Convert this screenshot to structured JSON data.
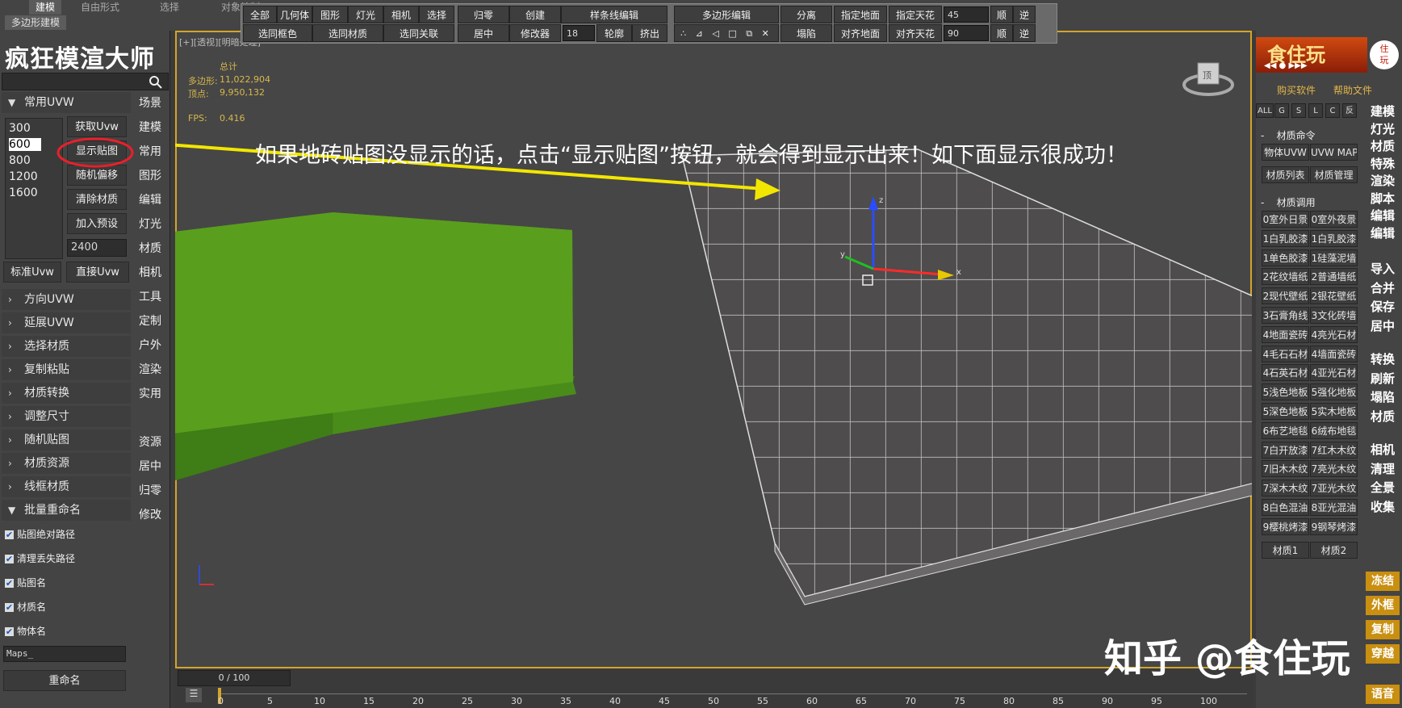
{
  "ribbon": {
    "tabs": [
      "建模",
      "自由形式",
      "选择",
      "对象绘制"
    ],
    "active_tab": "建模",
    "subtab": "多边形建模"
  },
  "toolbar": {
    "row1": [
      "全部",
      "几何体",
      "图形",
      "灯光",
      "相机",
      "选择",
      "归零",
      "创建",
      "样条线编辑",
      "多边形编辑",
      "分离",
      "指定地面",
      "指定天花",
      "顺",
      "逆"
    ],
    "row2": [
      "选同框色",
      "选同材质",
      "选同关联",
      "居中",
      "修改器",
      "轮廓",
      "挤出",
      "塌陷",
      "对齐地面",
      "对齐天花",
      "顺",
      "逆"
    ],
    "spinner_outline": "18",
    "spinner_angle1": "45",
    "spinner_angle2": "90"
  },
  "left": {
    "title": "疯狂模渲大师",
    "search_icon": "search-icon",
    "sec_common_uvw": "常用UVW",
    "sizes": [
      "300",
      "600",
      "800",
      "1200",
      "1600"
    ],
    "selected_size": "600",
    "btn_get_uvw": "获取Uvw",
    "btn_show_map": "显示贴图",
    "btn_random_offset": "随机偏移",
    "btn_clear_material": "清除材质",
    "btn_add_preset": "加入预设",
    "size_input": "2400",
    "btn_standard_uvw": "标准Uvw",
    "btn_direct_uvw": "直接Uvw",
    "nav": [
      "场景",
      "建模",
      "常用",
      "图形",
      "编辑",
      "灯光",
      "材质",
      "相机",
      "工具",
      "定制",
      "户外",
      "渲染",
      "实用",
      "资源",
      "居中",
      "归零",
      "修改"
    ],
    "sections": [
      "方向UVW",
      "延展UVW",
      "选择材质",
      "复制粘贴",
      "材质转换",
      "调整尺寸",
      "随机贴图",
      "材质资源",
      "线框材质"
    ],
    "sec_batch_rename": "批量重命名",
    "checks": [
      "贴图绝对路径",
      "清理丢失路径",
      "贴图名",
      "材质名",
      "物体名"
    ],
    "rename_input": "Maps_",
    "btn_rename": "重命名"
  },
  "viewport": {
    "label": "[+][透视][明暗处理]",
    "stats_title": "总计",
    "poly_label": "多边形:",
    "poly_value": "11,022,904",
    "vert_label": "顶点:",
    "vert_value": "9,950,132",
    "fps_label": "FPS:",
    "fps_value": "0.416",
    "annotation": "如果地砖贴图没显示的话，点击“显示贴图”按钮，就会得到显示出来！如下面显示很成功！",
    "gizmo_x": "x",
    "gizmo_y": "y",
    "gizmo_z": "z",
    "cube_label": "顶"
  },
  "timeline": {
    "slider": "0 / 100",
    "ticks": [
      "0",
      "5",
      "10",
      "15",
      "20",
      "25",
      "30",
      "35",
      "40",
      "45",
      "50",
      "55",
      "60",
      "65",
      "70",
      "75",
      "80",
      "85",
      "90",
      "95",
      "100"
    ]
  },
  "right": {
    "logo_text": "食住玩",
    "logo_sub": "住\n玩",
    "link_buy": "购买软件",
    "link_help": "帮助文件",
    "filters": [
      "ALL",
      "G",
      "S",
      "L",
      "C",
      "反"
    ],
    "head_material_cmd": "材质命令",
    "btn_obj_uvw": "物体UVW",
    "btn_uvw_map": "UVW MAP",
    "btn_mat_list": "材质列表",
    "btn_mat_manage": "材质管理",
    "head_material_call": "材质调用",
    "materials": [
      [
        "0室外日景",
        "0室外夜景"
      ],
      [
        "1白乳胶漆",
        "1白乳胶漆"
      ],
      [
        "1单色胶漆",
        "1硅藻泥墙"
      ],
      [
        "2花纹墙纸",
        "2普通墙纸"
      ],
      [
        "2现代壁纸",
        "2银花壁纸"
      ],
      [
        "3石膏角线",
        "3文化砖墙"
      ],
      [
        "4地面瓷砖",
        "4亮光石材"
      ],
      [
        "4毛石石材",
        "4墙面瓷砖"
      ],
      [
        "4石英石材",
        "4亚光石材"
      ],
      [
        "5浅色地板",
        "5强化地板"
      ],
      [
        "5深色地板",
        "5实木地板"
      ],
      [
        "6布艺地毯",
        "6绒布地毯"
      ],
      [
        "7白开放漆",
        "7红木木纹"
      ],
      [
        "7旧木木纹",
        "7亮光木纹"
      ],
      [
        "7深木木纹",
        "7亚光木纹"
      ],
      [
        "8白色混油",
        "8亚光混油"
      ],
      [
        "9樱桃烤漆",
        "9钢琴烤漆"
      ]
    ],
    "btn_mat1": "材质1",
    "btn_mat2": "材质2",
    "cmds_a": [
      "建模",
      "灯光",
      "材质",
      "特殊",
      "渲染",
      "脚本",
      "编辑",
      "编辑"
    ],
    "cmds_b": [
      "导入",
      "合并",
      "保存",
      "居中"
    ],
    "cmds_c": [
      "转换",
      "刷新",
      "塌陷",
      "材质"
    ],
    "cmds_d": [
      "相机",
      "清理",
      "全景",
      "收集"
    ],
    "yellow": [
      "冻结",
      "外框",
      "复制",
      "穿越",
      "语音"
    ]
  },
  "watermark": "知乎 @食住玩",
  "colors": {
    "viewport_border": "#d4a52b",
    "green_box": "#5a9e1e",
    "arrow": "#f2e600",
    "highlight_circle": "#e8202a",
    "yellow_button": "#c98f10"
  }
}
